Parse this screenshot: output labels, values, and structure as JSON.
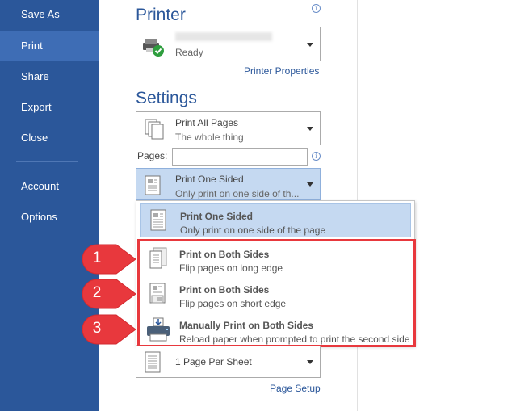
{
  "sidebar": {
    "items": [
      {
        "label": "Save As"
      },
      {
        "label": "Print"
      },
      {
        "label": "Share"
      },
      {
        "label": "Export"
      },
      {
        "label": "Close"
      },
      {
        "label": "Account"
      },
      {
        "label": "Options"
      }
    ],
    "active": "Print"
  },
  "printer": {
    "title": "Printer",
    "status": "Ready",
    "properties_link": "Printer Properties"
  },
  "settings": {
    "title": "Settings",
    "print_range": {
      "label": "Print All Pages",
      "desc": "The whole thing"
    },
    "pages_label": "Pages:",
    "pages_value": "",
    "sides": {
      "label": "Print One Sided",
      "desc": "Only print on one side of th..."
    },
    "per_sheet": {
      "label": "1 Page Per Sheet"
    },
    "page_setup_link": "Page Setup"
  },
  "sides_options": [
    {
      "label": "Print One Sided",
      "desc": "Only print on one side of the page",
      "selected": true
    },
    {
      "label": "Print on Both Sides",
      "desc": "Flip pages on long edge",
      "selected": false
    },
    {
      "label": "Print on Both Sides",
      "desc": "Flip pages on short edge",
      "selected": false
    },
    {
      "label": "Manually Print on Both Sides",
      "desc": "Reload paper when prompted to print the second side",
      "selected": false
    }
  ],
  "callouts": [
    "1",
    "2",
    "3"
  ],
  "colors": {
    "sidebar": "#2b579a",
    "sidebar_active": "#3e6db5",
    "accent_blue": "#2b579a",
    "selected_bg": "#c5d9f1",
    "callout_red": "#e8383d"
  }
}
